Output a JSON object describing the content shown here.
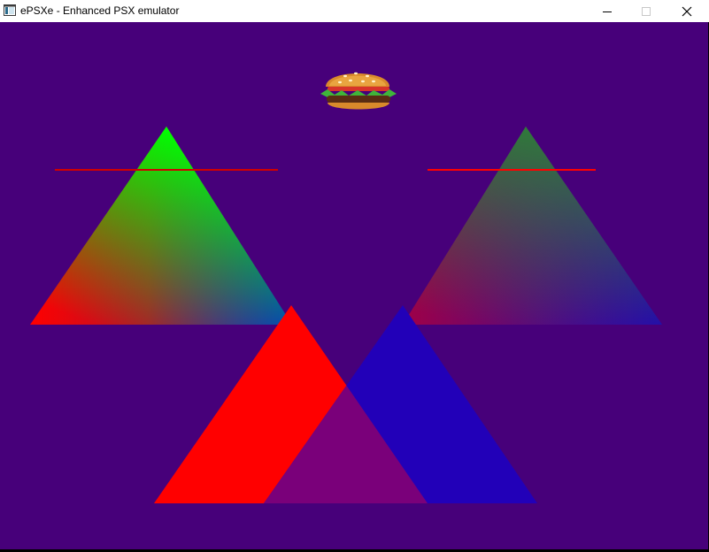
{
  "window": {
    "title": "ePSXe - Enhanced PSX emulator",
    "minimize_glyph": "–",
    "maximize_glyph": "□",
    "close_glyph": "✕"
  },
  "scene": {
    "background_color": "#47007a",
    "sprite_icon": "burger-icon",
    "colors": {
      "gouraud_left": [
        "#00ff00",
        "#ff0000",
        "#0000ff"
      ],
      "gouraud_right_blended": [
        "#2e7a3b",
        "#9c004a",
        "#2400b8"
      ],
      "flat_red": "#ff0000",
      "flat_blue_blended": "#2200b8",
      "overlap_purple": "#7a007a",
      "red_line": "#d00000",
      "red_line_right": "#ff0000"
    }
  }
}
